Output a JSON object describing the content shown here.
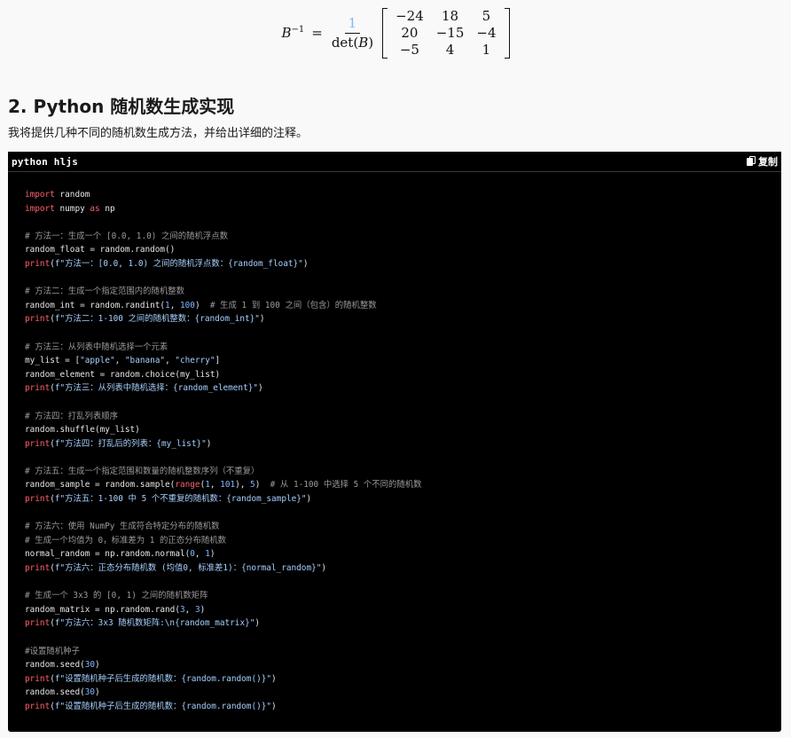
{
  "formula": {
    "lhs": "B",
    "sup": "−1",
    "eq": "=",
    "numerator": "1",
    "den_pre": "det(",
    "den_var": "B",
    "den_post": ")",
    "matrix": [
      [
        "−24",
        "18",
        "5"
      ],
      [
        "20",
        "−15",
        "−4"
      ],
      [
        "−5",
        "4",
        "1"
      ]
    ]
  },
  "heading": "2. Python 随机数生成实现",
  "intro": "我将提供几种不同的随机数生成方法，并给出详细的注释。",
  "code_block": {
    "language_label": "python hljs",
    "copy_label": "复制",
    "lines": [
      [
        [
          "kw",
          "import"
        ],
        [
          "pl",
          " random"
        ]
      ],
      [
        [
          "kw",
          "import"
        ],
        [
          "pl",
          " numpy "
        ],
        [
          "kw",
          "as"
        ],
        [
          "pl",
          " np"
        ]
      ],
      [],
      [
        [
          "com",
          "# 方法一：生成一个 [0.0, 1.0) 之间的随机浮点数"
        ]
      ],
      [
        [
          "pl",
          "random_float = random.random()"
        ]
      ],
      [
        [
          "fn",
          "print"
        ],
        [
          "pl",
          "("
        ],
        [
          "str",
          "f\"方法一：[0.0, 1.0) 之间的随机浮点数：{random_float}\""
        ],
        [
          "pl",
          ")"
        ]
      ],
      [],
      [
        [
          "com",
          "# 方法二：生成一个指定范围内的随机整数"
        ]
      ],
      [
        [
          "pl",
          "random_int = random.randint("
        ],
        [
          "num",
          "1"
        ],
        [
          "pl",
          ", "
        ],
        [
          "num",
          "100"
        ],
        [
          "pl",
          ")  "
        ],
        [
          "com",
          "# 生成 1 到 100 之间（包含）的随机整数"
        ]
      ],
      [
        [
          "fn",
          "print"
        ],
        [
          "pl",
          "("
        ],
        [
          "str",
          "f\"方法二：1-100 之间的随机整数：{random_int}\""
        ],
        [
          "pl",
          ")"
        ]
      ],
      [],
      [
        [
          "com",
          "# 方法三：从列表中随机选择一个元素"
        ]
      ],
      [
        [
          "pl",
          "my_list = ["
        ],
        [
          "str",
          "\"apple\""
        ],
        [
          "pl",
          ", "
        ],
        [
          "str",
          "\"banana\""
        ],
        [
          "pl",
          ", "
        ],
        [
          "str",
          "\"cherry\""
        ],
        [
          "pl",
          "]"
        ]
      ],
      [
        [
          "pl",
          "random_element = random.choice(my_list)"
        ]
      ],
      [
        [
          "fn",
          "print"
        ],
        [
          "pl",
          "("
        ],
        [
          "str",
          "f\"方法三：从列表中随机选择：{random_element}\""
        ],
        [
          "pl",
          ")"
        ]
      ],
      [],
      [
        [
          "com",
          "# 方法四：打乱列表顺序"
        ]
      ],
      [
        [
          "pl",
          "random.shuffle(my_list)"
        ]
      ],
      [
        [
          "fn",
          "print"
        ],
        [
          "pl",
          "("
        ],
        [
          "str",
          "f\"方法四：打乱后的列表：{my_list}\""
        ],
        [
          "pl",
          ")"
        ]
      ],
      [],
      [
        [
          "com",
          "# 方法五：生成一个指定范围和数量的随机整数序列（不重复）"
        ]
      ],
      [
        [
          "pl",
          "random_sample = random.sample("
        ],
        [
          "fn",
          "range"
        ],
        [
          "pl",
          "("
        ],
        [
          "num",
          "1"
        ],
        [
          "pl",
          ", "
        ],
        [
          "num",
          "101"
        ],
        [
          "pl",
          "), "
        ],
        [
          "num",
          "5"
        ],
        [
          "pl",
          ")  "
        ],
        [
          "com",
          "# 从 1-100 中选择 5 个不同的随机数"
        ]
      ],
      [
        [
          "fn",
          "print"
        ],
        [
          "pl",
          "("
        ],
        [
          "str",
          "f\"方法五：1-100 中 5 个不重复的随机数：{random_sample}\""
        ],
        [
          "pl",
          ")"
        ]
      ],
      [],
      [
        [
          "com",
          "# 方法六：使用 NumPy 生成符合特定分布的随机数"
        ]
      ],
      [
        [
          "com",
          "# 生成一个均值为 0，标准差为 1 的正态分布随机数"
        ]
      ],
      [
        [
          "pl",
          "normal_random = np.random.normal("
        ],
        [
          "num",
          "0"
        ],
        [
          "pl",
          ", "
        ],
        [
          "num",
          "1"
        ],
        [
          "pl",
          ")"
        ]
      ],
      [
        [
          "fn",
          "print"
        ],
        [
          "pl",
          "("
        ],
        [
          "str",
          "f\"方法六：正态分布随机数 (均值0, 标准差1)：{normal_random}\""
        ],
        [
          "pl",
          ")"
        ]
      ],
      [],
      [
        [
          "com",
          "# 生成一个 3x3 的 [0, 1) 之间的随机数矩阵"
        ]
      ],
      [
        [
          "pl",
          "random_matrix = np.random.rand("
        ],
        [
          "num",
          "3"
        ],
        [
          "pl",
          ", "
        ],
        [
          "num",
          "3"
        ],
        [
          "pl",
          ")"
        ]
      ],
      [
        [
          "fn",
          "print"
        ],
        [
          "pl",
          "("
        ],
        [
          "str",
          "f\"方法六：3x3 随机数矩阵:\\n{random_matrix}\""
        ],
        [
          "pl",
          ")"
        ]
      ],
      [],
      [
        [
          "com",
          "#设置随机种子"
        ]
      ],
      [
        [
          "pl",
          "random.seed("
        ],
        [
          "num",
          "30"
        ],
        [
          "pl",
          ")"
        ]
      ],
      [
        [
          "fn",
          "print"
        ],
        [
          "pl",
          "("
        ],
        [
          "str",
          "f\"设置随机种子后生成的随机数：{random.random()}\""
        ],
        [
          "pl",
          ")"
        ]
      ],
      [
        [
          "pl",
          "random.seed("
        ],
        [
          "num",
          "30"
        ],
        [
          "pl",
          ")"
        ]
      ],
      [
        [
          "fn",
          "print"
        ],
        [
          "pl",
          "("
        ],
        [
          "str",
          "f\"设置随机种子后生成的随机数：{random.random()}\""
        ],
        [
          "pl",
          ")"
        ]
      ]
    ]
  },
  "colors": {
    "code_bg": "#000000",
    "keyword": "#ff5e6c",
    "number": "#7fb6ff",
    "string": "#a6d0ff",
    "comment": "#9a9a9a"
  }
}
